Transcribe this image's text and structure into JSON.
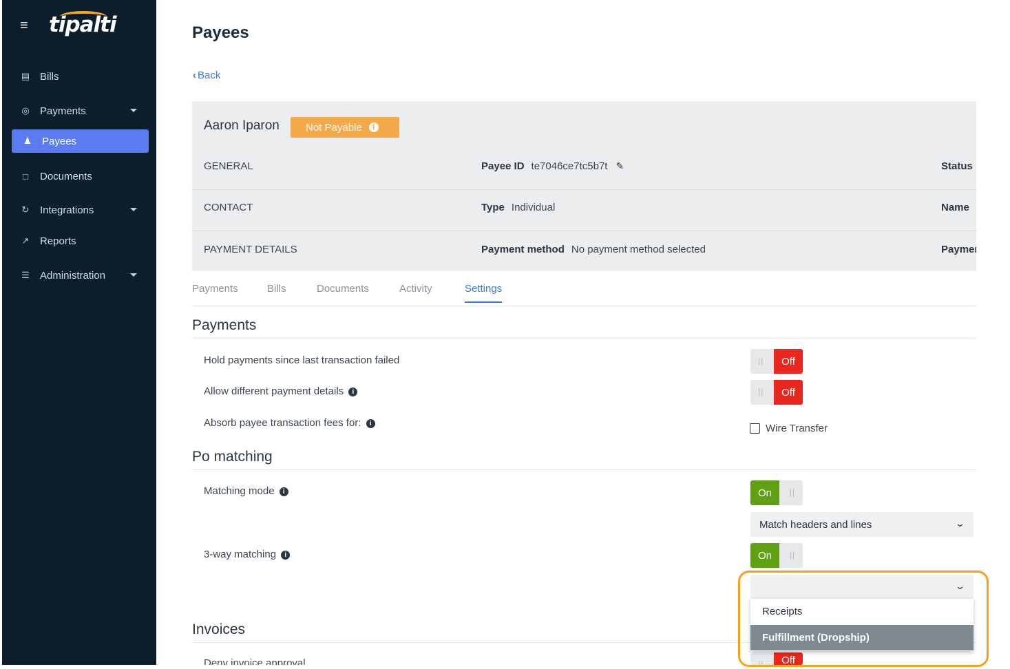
{
  "colors": {
    "sidebar_bg": "#0c1e2b",
    "accent_blue": "#5b7cf0",
    "link_blue": "#3a78d4",
    "badge_orange": "#f4a94a",
    "toggle_off_red": "#e8281e",
    "toggle_on_green": "#5fa014",
    "highlight_orange": "#f7a01b"
  },
  "brand": {
    "menu_icon": "hamburger-icon",
    "logo_text": "tipalti"
  },
  "sidebar": {
    "items": [
      {
        "label": "Bills",
        "icon": "bills-icon"
      },
      {
        "label": "Payments",
        "icon": "payments-icon"
      },
      {
        "label": "Payees",
        "icon": "payees-icon"
      },
      {
        "label": "Documents",
        "icon": "documents-icon"
      },
      {
        "label": "Integrations",
        "icon": "integrations-icon"
      },
      {
        "label": "Reports",
        "icon": "reports-icon"
      },
      {
        "label": "Administration",
        "icon": "administration-icon"
      }
    ],
    "active": "Payees"
  },
  "page": {
    "title": "Payees",
    "back_label": "Back"
  },
  "payee": {
    "name": "Aaron Iparon",
    "badge": "Not Payable",
    "rows": [
      {
        "section": "GENERAL",
        "field_label": "Payee ID",
        "field_value": "te7046ce7tc5b7t",
        "right_label": "Status"
      },
      {
        "section": "CONTACT",
        "field_label": "Type",
        "field_value": "Individual",
        "right_label": "Name"
      },
      {
        "section": "PAYMENT DETAILS",
        "field_label": "Payment method",
        "field_value": "No payment method selected",
        "right_label": "Payment"
      }
    ]
  },
  "tabs": [
    "Payments",
    "Bills",
    "Documents",
    "Activity",
    "Settings"
  ],
  "active_tab": "Settings",
  "settings": {
    "payments": {
      "title": "Payments",
      "hold_label": "Hold payments since last transaction failed",
      "hold_state": "Off",
      "allow_label": "Allow different payment details",
      "allow_state": "Off",
      "absorb_label": "Absorb payee transaction fees for:",
      "wire_label": "Wire Transfer",
      "wire_checked": false
    },
    "po_matching": {
      "title": "Po matching",
      "mode_label": "Matching mode",
      "mode_state": "On",
      "mode_select": "Match headers and lines",
      "threeway_label": "3-way matching",
      "threeway_state": "On",
      "threeway_select": "",
      "options": [
        "Receipts",
        "Fulfillment (Dropship)"
      ],
      "highlighted_option": "Fulfillment (Dropship)"
    },
    "invoices": {
      "title": "Invoices",
      "deny_label": "Deny invoice approval",
      "deny_state": "Off"
    }
  },
  "grip_glyph": "||",
  "info_glyph": "i"
}
